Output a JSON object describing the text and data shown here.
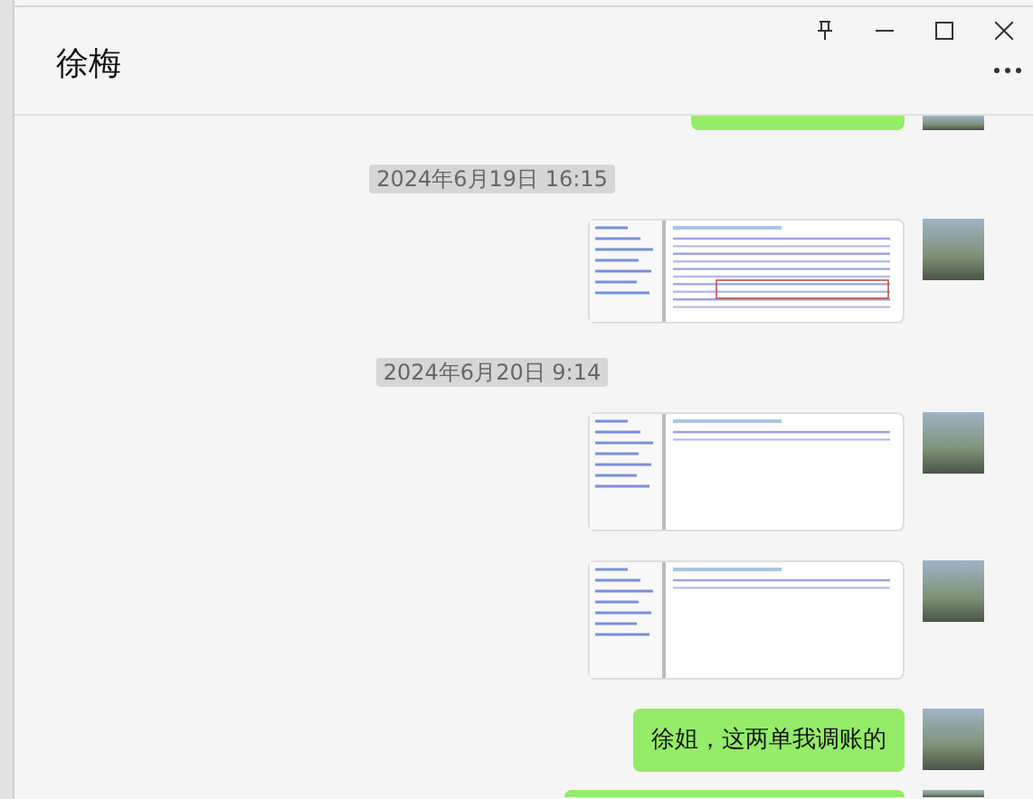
{
  "window": {
    "title": "徐梅"
  },
  "messages": [
    {
      "kind": "cropped-bubble",
      "outgoing": true
    },
    {
      "kind": "timestamp",
      "text": "2024年6月19日 16:15"
    },
    {
      "kind": "image",
      "outgoing": true
    },
    {
      "kind": "timestamp",
      "text": "2024年6月20日 9:14"
    },
    {
      "kind": "image",
      "outgoing": true
    },
    {
      "kind": "image",
      "outgoing": true
    },
    {
      "kind": "text",
      "outgoing": true,
      "text": "徐姐，这两单我调账的"
    },
    {
      "kind": "cropped-bubble",
      "outgoing": true
    }
  ]
}
